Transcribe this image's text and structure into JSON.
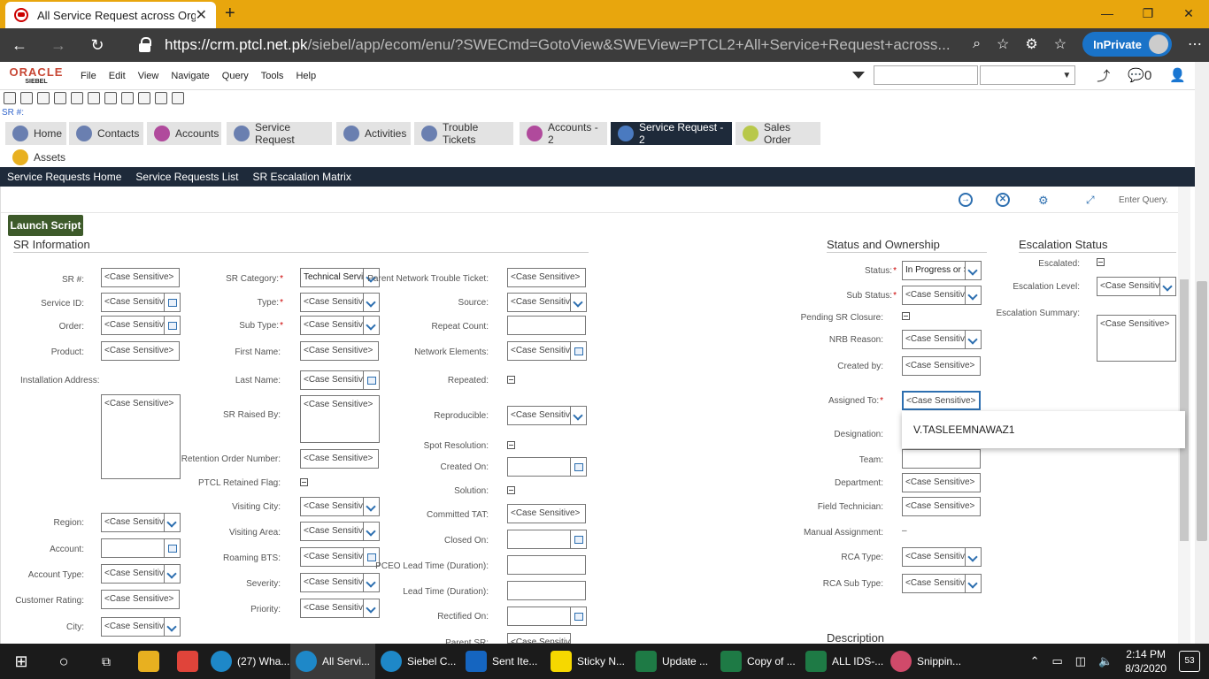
{
  "browser": {
    "tab_title": "All Service Request across Organ",
    "new_tab_icon": "plus-icon",
    "url_host": "https://crm.ptcl.net.pk",
    "url_path": "/siebel/app/ecom/enu/?SWECmd=GotoView&SWEView=PTCL2+All+Service+Request+across...",
    "inprivate_label": "InPrivate"
  },
  "app": {
    "logo_oracle": "ORACLE",
    "logo_siebel": "SIEBEL",
    "menus": [
      "File",
      "Edit",
      "View",
      "Navigate",
      "Query",
      "Tools",
      "Help"
    ],
    "notif_count": "0",
    "sr_hash_label": "SR #:"
  },
  "screen_tabs": [
    "Home",
    "Contacts",
    "Accounts",
    "Service Request",
    "Activities",
    "Trouble Tickets",
    "Accounts - 2",
    "Service Request - 2",
    "Sales Order",
    "Assets"
  ],
  "view_tabs": [
    "Service Requests Home",
    "Service Requests List",
    "SR Escalation Matrix"
  ],
  "applet": {
    "enter_query": "Enter Query.",
    "launch_script": "Launch Script",
    "sections": {
      "sr_info": "SR Information",
      "status": "Status and Ownership",
      "escalation": "Escalation Status",
      "description": "Description"
    },
    "placeholder": "<Case Sensitive>",
    "col1": {
      "sr": "SR #:",
      "service_id": "Service ID:",
      "order": "Order:",
      "product": "Product:",
      "install_addr": "Installation Address:",
      "region": "Region:",
      "account": "Account:",
      "account_type": "Account Type:",
      "customer_rating": "Customer Rating:",
      "city": "City:"
    },
    "col2": {
      "sr_category": "SR Category:",
      "sr_category_value": "Technical Servic",
      "type": "Type:",
      "sub_type": "Sub Type:",
      "first_name": "First Name:",
      "last_name": "Last Name:",
      "sr_raised_by": "SR Raised By:",
      "retention_order": "Retention Order Number:",
      "ptcl_retained": "PTCL Retained Flag:",
      "visiting_city": "Visiting City:",
      "visiting_area": "Visiting Area:",
      "roaming_bts": "Roaming BTS:",
      "severity": "Severity:",
      "priority": "Priority:"
    },
    "col3": {
      "parent_ntt": "Parent Network Trouble Ticket:",
      "source": "Source:",
      "repeat_count": "Repeat Count:",
      "network_elements": "Network Elements:",
      "repeated": "Repeated:",
      "reproducible": "Reproducible:",
      "spot_resolution": "Spot Resolution:",
      "created_on": "Created On:",
      "solution": "Solution:",
      "committed_tat": "Committed TAT:",
      "closed_on": "Closed On:",
      "pceo_lead": "PCEO Lead Time (Duration):",
      "lead_time": "Lead Time (Duration):",
      "rectified_on": "Rectified On:",
      "parent_sr": "Parent SR:"
    },
    "col4": {
      "status": "Status:",
      "status_value": "In Progress or S",
      "sub_status": "Sub Status:",
      "pending_closure": "Pending SR Closure:",
      "nrb_reason": "NRB Reason:",
      "created_by": "Created by:",
      "assigned_to": "Assigned To:",
      "designation": "Designation:",
      "team": "Team:",
      "department": "Department:",
      "field_tech": "Field Technician:",
      "manual_assign": "Manual Assignment:",
      "manual_assign_value": "–",
      "rca_type": "RCA Type:",
      "rca_sub_type": "RCA Sub Type:"
    },
    "col5": {
      "escalated": "Escalated:",
      "escalation_level": "Escalation Level:",
      "escalation_summary": "Escalation Summary:"
    },
    "popup_item": "V.TASLEEMNAWAZ1"
  },
  "taskbar": {
    "items": [
      "(27) Wha...",
      "All Servi...",
      "Siebel C...",
      "Sent Ite...",
      "Sticky N...",
      "Update ...",
      "Copy of ...",
      "ALL IDS-...",
      "Snippin..."
    ],
    "time": "2:14 PM",
    "date": "8/3/2020",
    "notif_count": "53"
  }
}
